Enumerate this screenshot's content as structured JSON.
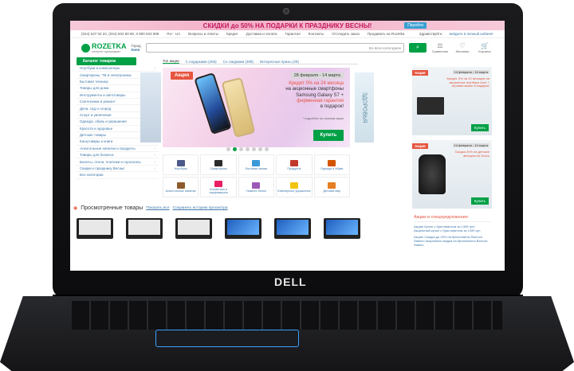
{
  "promo": {
    "text": "СКИДКИ до 50% НА ПОДАРКИ К ПРАЗДНИКУ ВЕСНЫ!",
    "button": "Перейти"
  },
  "topbar": {
    "phones": "(044) 537 02 22, (044) 503 80 80, 0 800 503 808",
    "lang": "RU · UA",
    "links": [
      "Вопросы и ответы",
      "Кредит",
      "Доставка и оплата",
      "Гарантия",
      "Контакты",
      "Отследить заказ",
      "Продавать на Rozetka"
    ],
    "greeting": "Здравствуйте,",
    "login": "войдите в личный кабинет"
  },
  "header": {
    "brand": "ROZETKA",
    "brand_sub": "интернет-супермаркет",
    "city_label": "Город",
    "city": "Киев",
    "search_placeholder": "",
    "category_select": "Во всех категориях",
    "icons": [
      {
        "label": "Сравнение",
        "icon": "compare-icon"
      },
      {
        "label": "Желания",
        "icon": "heart-icon"
      },
      {
        "label": "Корзина",
        "icon": "cart-icon"
      }
    ]
  },
  "sidebar": {
    "title": "Каталог товаров",
    "items": [
      "Ноутбуки и компьютеры",
      "Смартфоны, ТВ и электроника",
      "Бытовая техника",
      "Товары для дома",
      "Инструменты и автотовары",
      "Сантехника и ремонт",
      "Дача, сад и огород",
      "Спорт и увлечения",
      "Одежда, обувь и украшения",
      "Красота и здоровье",
      "Детские товары",
      "Канцтовары и книги",
      "Алкогольные напитки и продукты",
      "Товары для бизнеса",
      "Билеты, отели, платежи и гороскопы",
      "Скидки к празднику Весны!",
      "Все категории"
    ]
  },
  "main": {
    "tabs": [
      "Топ акции",
      "С подарками (255)",
      "Со скидками (399)",
      "Интересные призы (29)"
    ],
    "banner": {
      "badge": "Акция",
      "dates": "28 февраля - 14 марта",
      "line1": "Кредит 0% на 24 месяца",
      "line2": "на акционные смартфоны",
      "line3": "Samsung Galaxy S7 +",
      "line4": "фирменная гарантия",
      "line5": "в подарок!",
      "note": "* подробнее на странице акции",
      "button": "Купить"
    },
    "next_peek": "ЗДОРОВЬЯ",
    "categories": [
      {
        "label": "Ноутбуки",
        "color": "#4a5a8a"
      },
      {
        "label": "Смартфоны",
        "color": "#2c2c2c"
      },
      {
        "label": "Бытовая химия",
        "color": "#3a9ad9"
      },
      {
        "label": "Продукты",
        "color": "#c0392b"
      },
      {
        "label": "Одежда и обувь",
        "color": "#d35400"
      },
      {
        "label": "Алкогольные напитки",
        "color": "#8e5a2b"
      },
      {
        "label": "Косметика и парфюмерия",
        "color": "#e91e63"
      },
      {
        "label": "Нижнее белье",
        "color": "#9b59b6"
      },
      {
        "label": "Ювелирные украшения",
        "color": "#f1c40f"
      },
      {
        "label": "Детский мир",
        "color": "#e67e22"
      }
    ],
    "viewed": {
      "title": "Просмотренные товары",
      "show_all": "Показать все",
      "save": "Сохранить историю просмотра"
    }
  },
  "aside": {
    "ad1": {
      "badge": "Акция",
      "dates": "14 февраля - 14 марта",
      "text": "Кредит 0% на 10 месяцев на акционные ноутбуки Acer + игровая мышь в подарок!",
      "button": "Купить"
    },
    "ad2": {
      "badge": "Акция",
      "dates": "14 февраля - 14 марта",
      "text": "Скидка 20% на детские автокресла Graco",
      "button": "Купить"
    },
    "discounts": {
      "title": "Акции и спецпредложения",
      "items": [
        "Акция! Купон с бриллиантом за 1399 грн! Акционный купон с бриллиантом за 1399 грн",
        "Акция! Скидка до 25% на бриллианты Barrock Station! Акционная скидка на бриллианты Barrock Station"
      ]
    }
  },
  "laptop": {
    "logo": "DELL"
  }
}
